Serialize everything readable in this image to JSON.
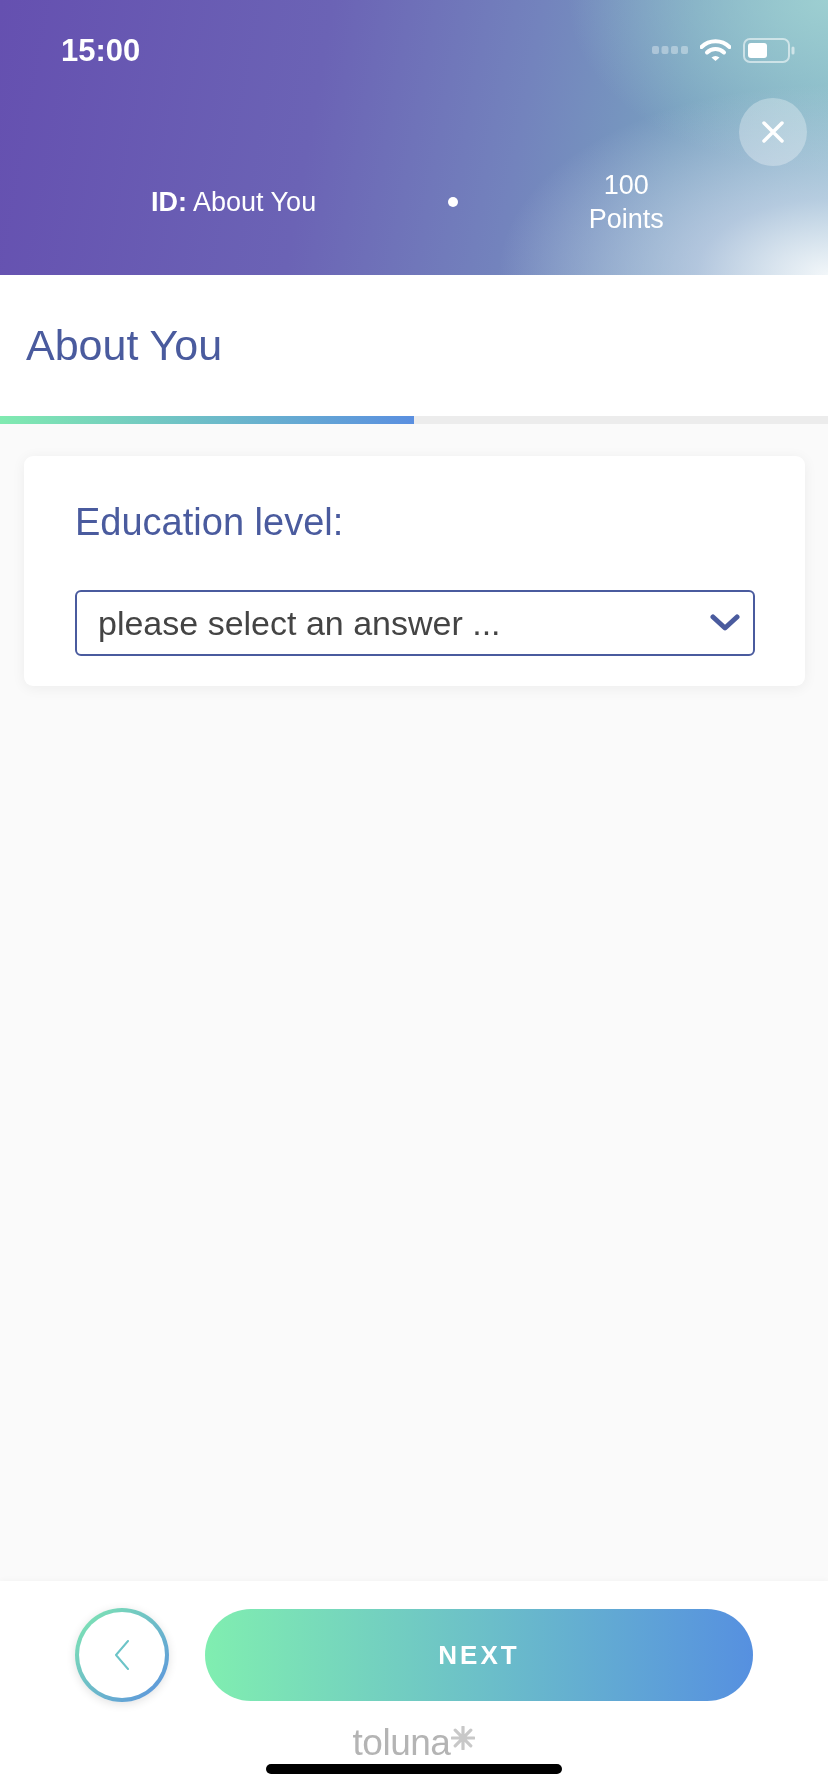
{
  "status_bar": {
    "time": "15:00"
  },
  "header": {
    "survey_id": "**ID:** About You",
    "points_value": "100",
    "points_label": "Points"
  },
  "page": {
    "title": "About You",
    "progress": {
      "level": 0.5
    }
  },
  "question": {
    "label": "Education level:",
    "dropdown": {
      "placeholder": "please select an answer ..."
    }
  },
  "footer": {
    "next_button": "NEXT",
    "logo": "toluna"
  }
}
